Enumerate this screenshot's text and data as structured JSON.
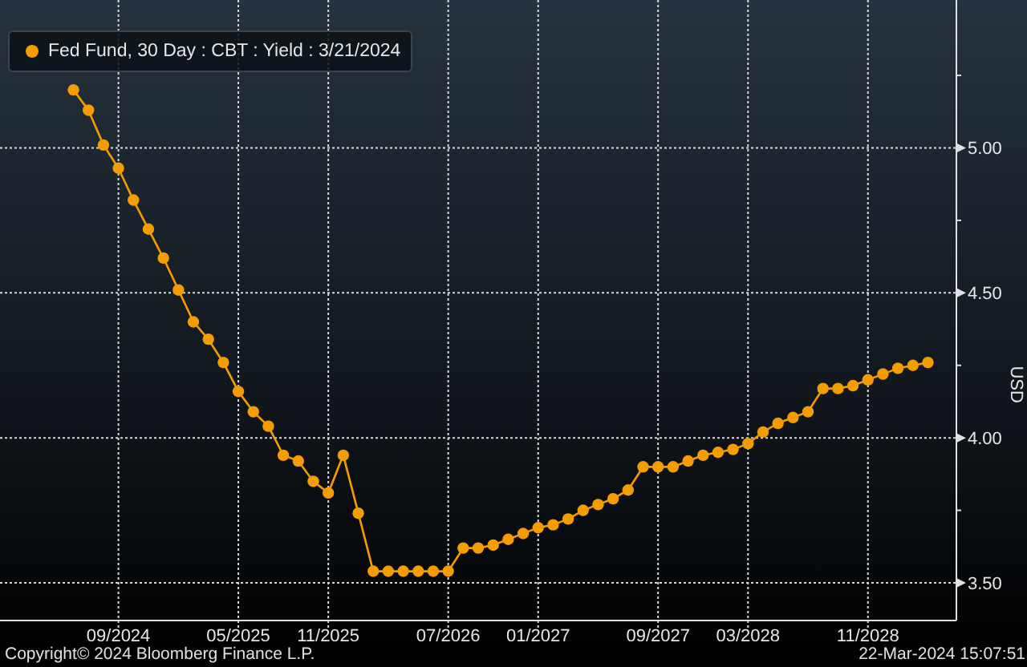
{
  "chart": {
    "chart_data": {
      "type": "line",
      "ylabel": "USD",
      "grid": true,
      "categories": [
        null,
        null,
        null,
        null,
        "09/2024",
        null,
        null,
        null,
        null,
        null,
        null,
        null,
        "05/2025",
        null,
        null,
        null,
        null,
        null,
        "11/2025",
        null,
        null,
        null,
        null,
        null,
        null,
        null,
        "07/2026",
        null,
        null,
        null,
        null,
        null,
        "01/2027",
        null,
        null,
        null,
        null,
        null,
        null,
        null,
        "09/2027",
        null,
        null,
        null,
        null,
        null,
        "03/2028",
        null,
        null,
        null,
        null,
        null,
        null,
        null,
        "11/2028",
        null,
        null,
        null,
        null
      ],
      "series": [
        {
          "name": "Fed Fund, 30 Day : CBT : Yield : 3/21/2024",
          "color": "#f59c00",
          "marker": "circle",
          "values": [
            null,
            5.2,
            5.13,
            5.01,
            4.93,
            4.82,
            4.72,
            4.62,
            4.51,
            4.4,
            4.34,
            4.26,
            4.16,
            4.09,
            4.04,
            3.94,
            3.92,
            3.85,
            3.81,
            3.94,
            3.74,
            3.54,
            3.54,
            3.54,
            3.54,
            3.54,
            3.54,
            3.62,
            3.62,
            3.63,
            3.65,
            3.67,
            3.69,
            3.7,
            3.72,
            3.75,
            3.77,
            3.79,
            3.82,
            3.9,
            3.9,
            3.9,
            3.92,
            3.94,
            3.95,
            3.96,
            3.98,
            4.02,
            4.05,
            4.07,
            4.09,
            4.17,
            4.17,
            4.18,
            4.2,
            4.22,
            4.24,
            4.25,
            4.26
          ]
        }
      ],
      "ylim": [
        3.37,
        5.51
      ],
      "yticks": [
        {
          "value": 3.5,
          "label": "3.50"
        },
        {
          "value": 4,
          "label": "4.00"
        },
        {
          "value": 4.5,
          "label": "4.50"
        },
        {
          "value": 5,
          "label": "5.00"
        }
      ]
    }
  },
  "footer": {
    "copyright": "Copyright© 2024 Bloomberg Finance L.P.",
    "timestamp": "22-Mar-2024 15:07:51"
  }
}
